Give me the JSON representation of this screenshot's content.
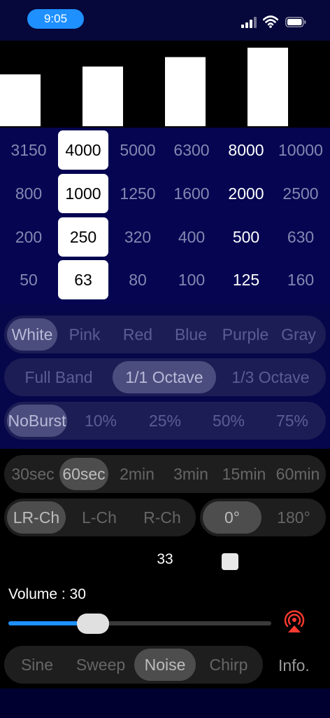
{
  "status": {
    "time": "9:05"
  },
  "level_bars": {
    "values": [
      0.66,
      0.76,
      0.88,
      1.0
    ]
  },
  "frequency_grid": {
    "rows": [
      [
        "3150",
        "4000",
        "5000",
        "6300",
        "8000",
        "10000"
      ],
      [
        "800",
        "1000",
        "1250",
        "1600",
        "2000",
        "2500"
      ],
      [
        "200",
        "250",
        "320",
        "400",
        "500",
        "630"
      ],
      [
        "50",
        "63",
        "80",
        "100",
        "125",
        "160"
      ]
    ],
    "selected_column": 1,
    "bright_column": 4
  },
  "noise_color": {
    "options": [
      "White",
      "Pink",
      "Red",
      "Blue",
      "Purple",
      "Gray"
    ],
    "selected": "White"
  },
  "band": {
    "options": [
      "Full Band",
      "1/1 Octave",
      "1/3 Octave"
    ],
    "selected": "1/1 Octave"
  },
  "burst": {
    "options": [
      "NoBurst",
      "10%",
      "25%",
      "50%",
      "75%"
    ],
    "selected": "NoBurst"
  },
  "duration": {
    "options": [
      "30sec",
      "60sec",
      "2min",
      "3min",
      "15min",
      "60min"
    ],
    "selected": "60sec"
  },
  "channel": {
    "options": [
      "LR-Ch",
      "L-Ch",
      "R-Ch"
    ],
    "selected": "LR-Ch"
  },
  "phase": {
    "options": [
      "0°",
      "180°"
    ],
    "selected": "0°"
  },
  "counter": "33",
  "volume": {
    "label": "Volume : 30",
    "level": 0.3
  },
  "mode": {
    "options": [
      "Sine",
      "Sweep",
      "Noise",
      "Chirp"
    ],
    "selected": "Noise"
  },
  "info_label": "Info.",
  "colors": {
    "accent": "#1e90ff",
    "airplay": "#ff3b30"
  }
}
